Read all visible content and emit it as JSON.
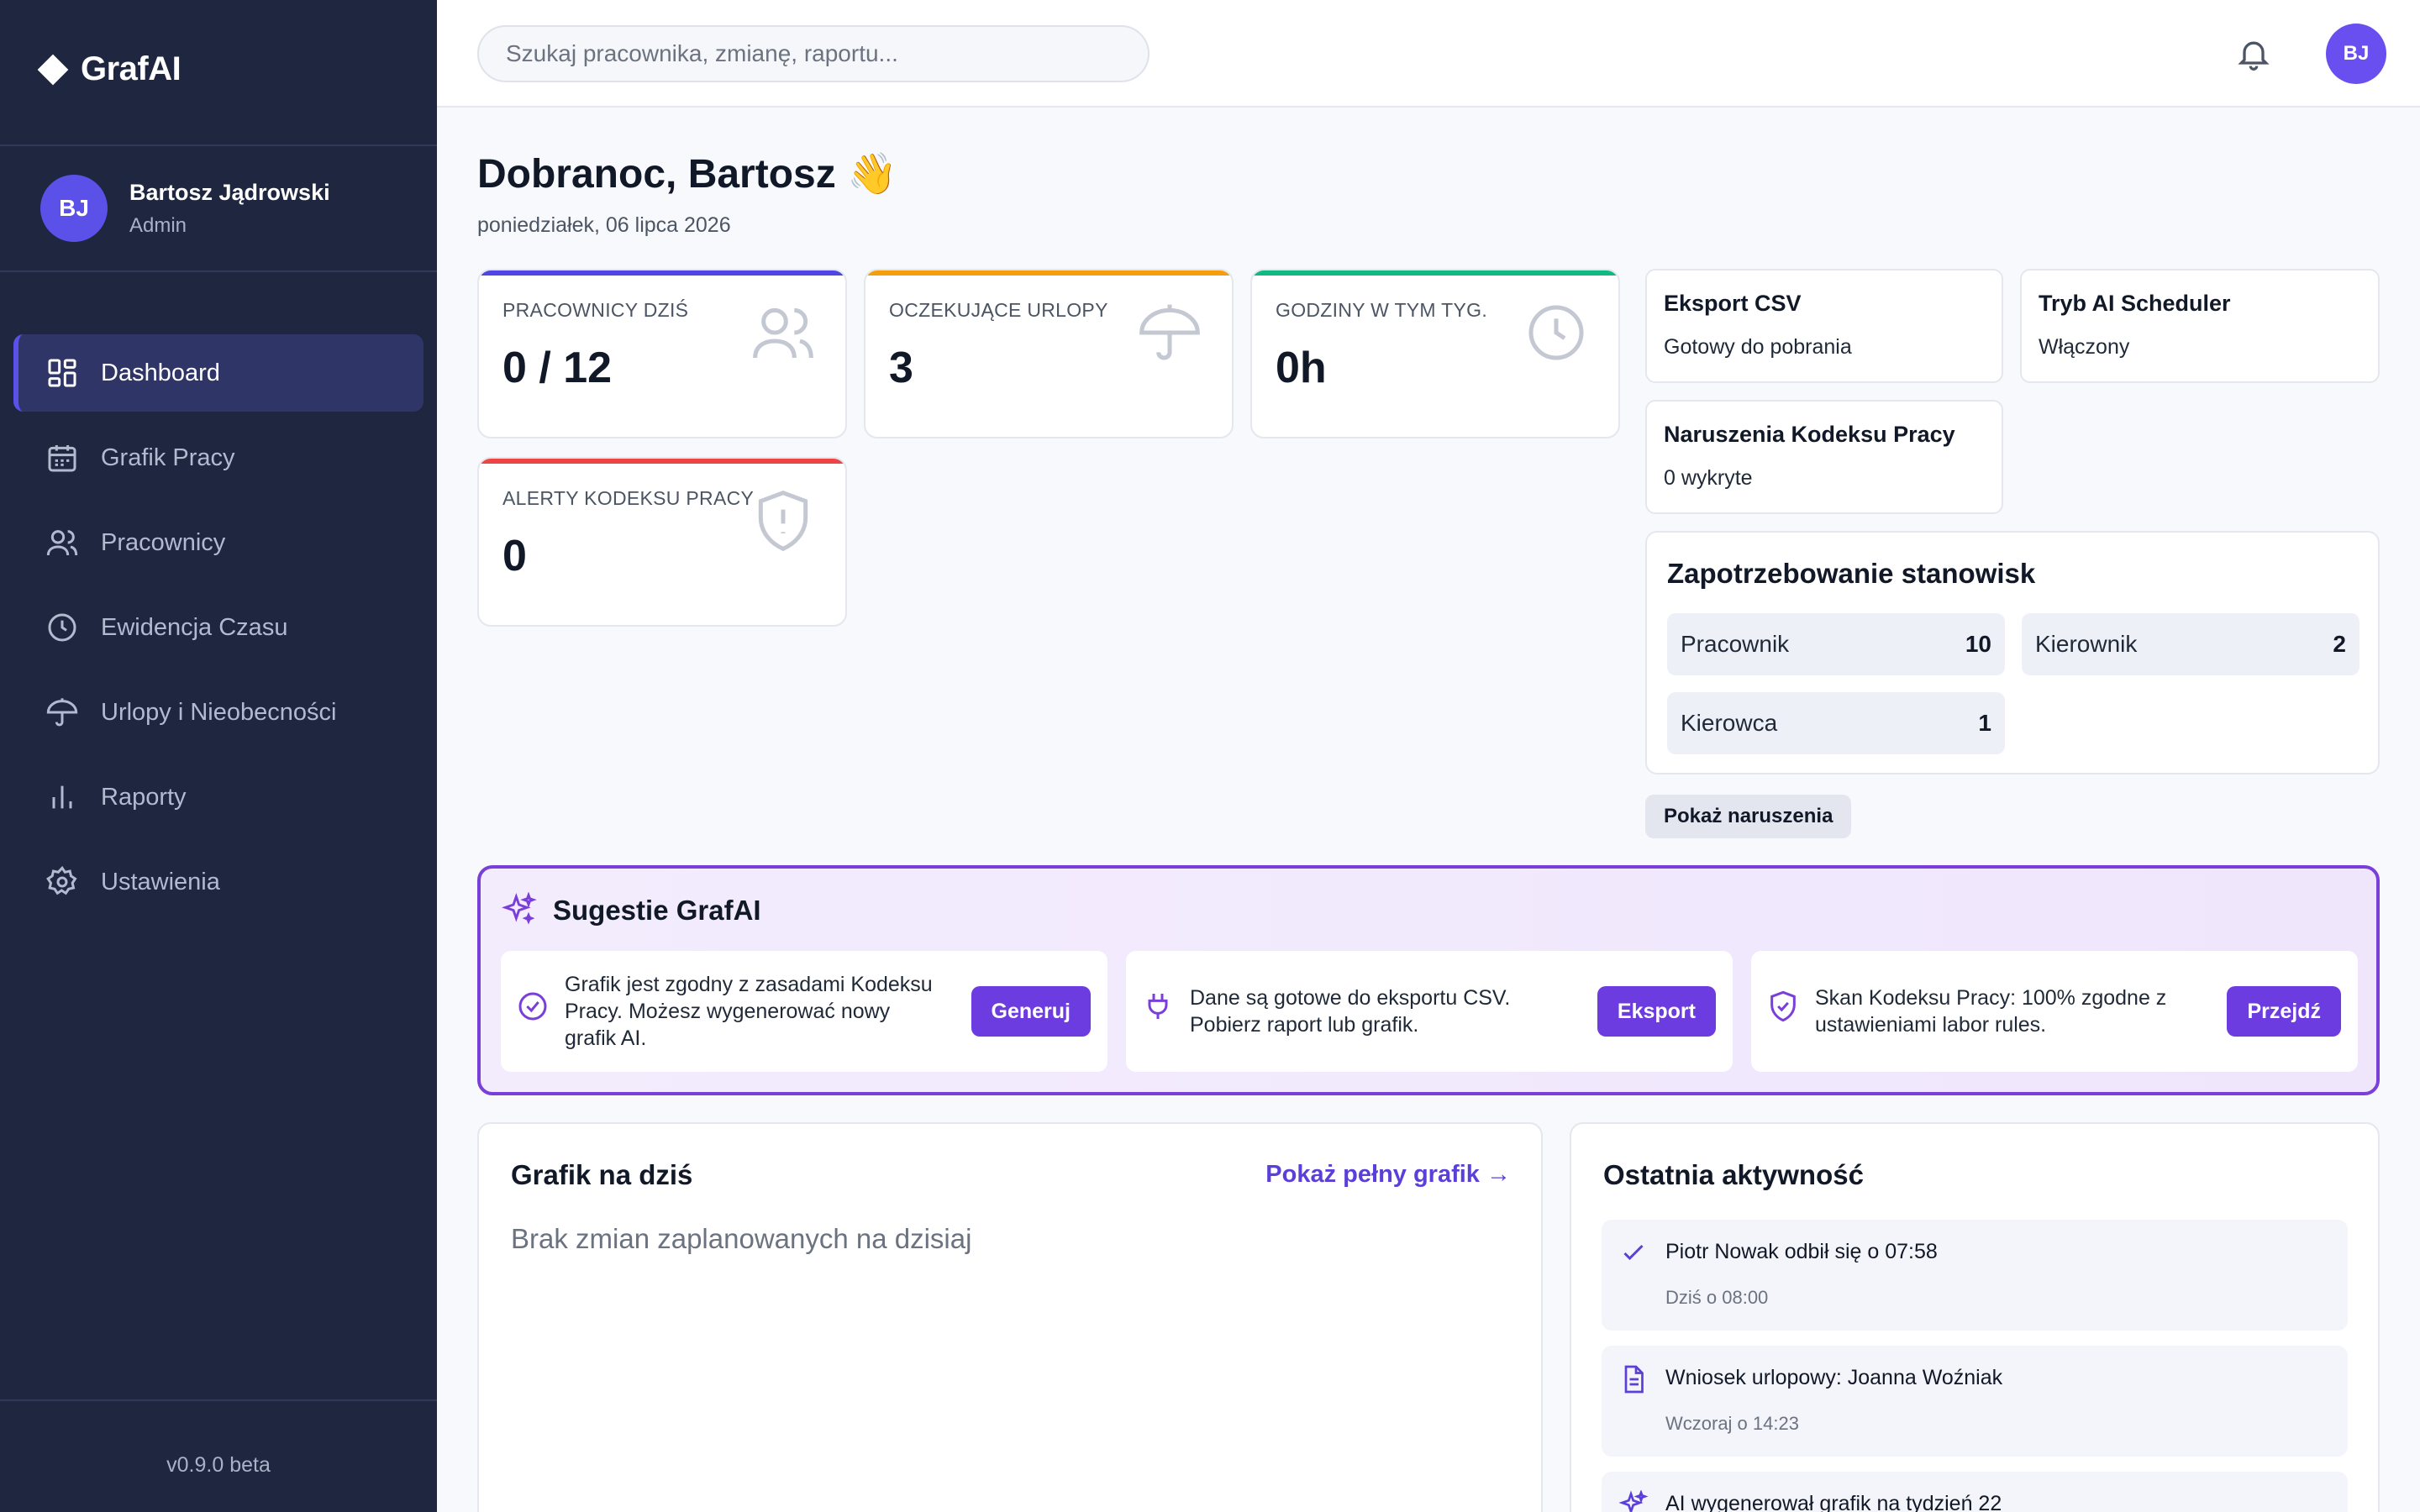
{
  "sidebar": {
    "brand": "GrafAI",
    "user": {
      "initials": "BJ",
      "name": "Bartosz Jądrowski",
      "role": "Admin"
    },
    "items": [
      {
        "label": "Dashboard",
        "icon": "dashboard-icon",
        "active": true
      },
      {
        "label": "Grafik Pracy",
        "icon": "calendar-icon"
      },
      {
        "label": "Pracownicy",
        "icon": "users-icon"
      },
      {
        "label": "Ewidencja Czasu",
        "icon": "clock-icon"
      },
      {
        "label": "Urlopy i Nieobecności",
        "icon": "umbrella-icon"
      },
      {
        "label": "Raporty",
        "icon": "bar-chart-icon"
      },
      {
        "label": "Ustawienia",
        "icon": "gear-icon"
      }
    ],
    "version": "v0.9.0 beta"
  },
  "topbar": {
    "search_placeholder": "Szukaj pracownika, zmianę, raportu...",
    "avatar_initials": "BJ"
  },
  "header": {
    "greeting": "Dobranoc, Bartosz",
    "emoji": "👋",
    "date": "poniedziałek, 06 lipca 2026"
  },
  "stats": [
    {
      "label": "Pracownicy dziś",
      "value": "0 / 12",
      "color": "#4f46e5",
      "icon": "users-icon"
    },
    {
      "label": "Oczekujące urlopy",
      "value": "3",
      "color": "#f59e0b",
      "icon": "umbrella-icon"
    },
    {
      "label": "Godziny w tym tyg.",
      "value": "0h",
      "color": "#10b981",
      "icon": "clock-icon"
    },
    {
      "label": "Alerty Kodeksu Pracy",
      "value": "0",
      "color": "#ef4444",
      "icon": "shield-alert-icon"
    }
  ],
  "info_cards": {
    "csv": {
      "title": "Eksport CSV",
      "subtitle": "Gotowy do pobrania"
    },
    "ai_mode": {
      "title": "Tryb AI Scheduler",
      "subtitle": "Włączony"
    },
    "violations": {
      "title": "Naruszenia Kodeksu Pracy",
      "subtitle": "0 wykryte"
    }
  },
  "demand": {
    "title": "Zapotrzebowanie stanowisk",
    "items": [
      {
        "role": "Pracownik",
        "count": "10"
      },
      {
        "role": "Kierownik",
        "count": "2"
      },
      {
        "role": "Kierowca",
        "count": "1"
      }
    ],
    "button": "Pokaż naruszenia"
  },
  "ai_suggestions": {
    "title": "Sugestie GrafAI",
    "accent": "#7a3fd8",
    "items": [
      {
        "icon": "check-circle-icon",
        "text": "Grafik jest zgodny z zasadami Kodeksu Pracy. Możesz wygenerować nowy grafik AI.",
        "button": "Generuj"
      },
      {
        "icon": "plug-icon",
        "text": "Dane są gotowe do eksportu CSV. Pobierz raport lub grafik.",
        "button": "Eksport"
      },
      {
        "icon": "shield-check-icon",
        "text": "Skan Kodeksu Pracy: 100% zgodne z ustawieniami labor rules.",
        "button": "Przejdź"
      }
    ]
  },
  "schedule_today": {
    "title": "Grafik na dziś",
    "link": "Pokaż pełny grafik →",
    "empty": "Brak zmian zaplanowanych na dzisiaj"
  },
  "activity": {
    "title": "Ostatnia aktywność",
    "items": [
      {
        "icon": "check-icon",
        "text": "Piotr Nowak odbił się o 07:58",
        "time": "Dziś o 08:00"
      },
      {
        "icon": "document-icon",
        "text": "Wniosek urlopowy: Joanna Woźniak",
        "time": "Wczoraj o 14:23"
      },
      {
        "icon": "sparkles-icon",
        "text": "AI wygenerował grafik na tydzień 22",
        "time": ""
      }
    ]
  }
}
